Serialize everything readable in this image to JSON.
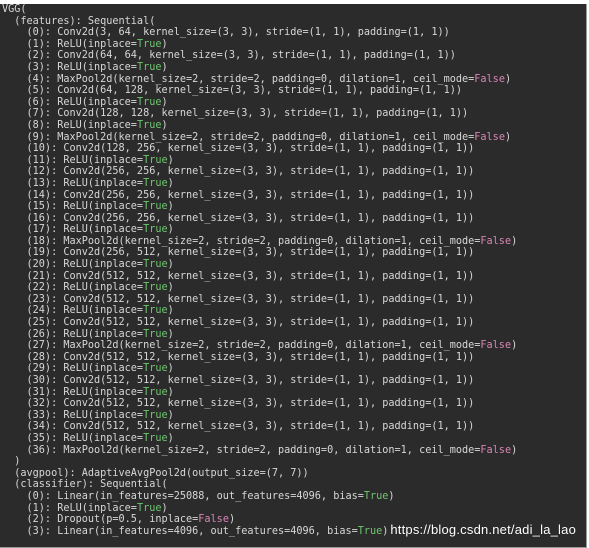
{
  "terminal_lines": [
    "VGG(",
    "  (features): Sequential(",
    "    (0): Conv2d(3, 64, kernel_size=(3, 3), stride=(1, 1), padding=(1, 1))",
    "    (1): ReLU(inplace=True)",
    "    (2): Conv2d(64, 64, kernel_size=(3, 3), stride=(1, 1), padding=(1, 1))",
    "    (3): ReLU(inplace=True)",
    "    (4): MaxPool2d(kernel_size=2, stride=2, padding=0, dilation=1, ceil_mode=False)",
    "    (5): Conv2d(64, 128, kernel_size=(3, 3), stride=(1, 1), padding=(1, 1))",
    "    (6): ReLU(inplace=True)",
    "    (7): Conv2d(128, 128, kernel_size=(3, 3), stride=(1, 1), padding=(1, 1))",
    "    (8): ReLU(inplace=True)",
    "    (9): MaxPool2d(kernel_size=2, stride=2, padding=0, dilation=1, ceil_mode=False)",
    "    (10): Conv2d(128, 256, kernel_size=(3, 3), stride=(1, 1), padding=(1, 1))",
    "    (11): ReLU(inplace=True)",
    "    (12): Conv2d(256, 256, kernel_size=(3, 3), stride=(1, 1), padding=(1, 1))",
    "    (13): ReLU(inplace=True)",
    "    (14): Conv2d(256, 256, kernel_size=(3, 3), stride=(1, 1), padding=(1, 1))",
    "    (15): ReLU(inplace=True)",
    "    (16): Conv2d(256, 256, kernel_size=(3, 3), stride=(1, 1), padding=(1, 1))",
    "    (17): ReLU(inplace=True)",
    "    (18): MaxPool2d(kernel_size=2, stride=2, padding=0, dilation=1, ceil_mode=False)",
    "    (19): Conv2d(256, 512, kernel_size=(3, 3), stride=(1, 1), padding=(1, 1))",
    "    (20): ReLU(inplace=True)",
    "    (21): Conv2d(512, 512, kernel_size=(3, 3), stride=(1, 1), padding=(1, 1))",
    "    (22): ReLU(inplace=True)",
    "    (23): Conv2d(512, 512, kernel_size=(3, 3), stride=(1, 1), padding=(1, 1))",
    "    (24): ReLU(inplace=True)",
    "    (25): Conv2d(512, 512, kernel_size=(3, 3), stride=(1, 1), padding=(1, 1))",
    "    (26): ReLU(inplace=True)",
    "    (27): MaxPool2d(kernel_size=2, stride=2, padding=0, dilation=1, ceil_mode=False)",
    "    (28): Conv2d(512, 512, kernel_size=(3, 3), stride=(1, 1), padding=(1, 1))",
    "    (29): ReLU(inplace=True)",
    "    (30): Conv2d(512, 512, kernel_size=(3, 3), stride=(1, 1), padding=(1, 1))",
    "    (31): ReLU(inplace=True)",
    "    (32): Conv2d(512, 512, kernel_size=(3, 3), stride=(1, 1), padding=(1, 1))",
    "    (33): ReLU(inplace=True)",
    "    (34): Conv2d(512, 512, kernel_size=(3, 3), stride=(1, 1), padding=(1, 1))",
    "    (35): ReLU(inplace=True)",
    "    (36): MaxPool2d(kernel_size=2, stride=2, padding=0, dilation=1, ceil_mode=False)",
    "  )",
    "  (avgpool): AdaptiveAvgPool2d(output_size=(7, 7))",
    "  (classifier): Sequential(",
    "    (0): Linear(in_features=25088, out_features=4096, bias=True)",
    "    (1): ReLU(inplace=True)",
    "    (2): Dropout(p=0.5, inplace=False)",
    "    (3): Linear(in_features=4096, out_features=4096, bias=True)"
  ],
  "watermark": "https://blog.csdn.net/adi_la_lao",
  "colors": {
    "background": "#2b2b2b",
    "text": "#d7d7d7",
    "true_keyword": "#6fc66f",
    "false_keyword": "#d985b6"
  }
}
